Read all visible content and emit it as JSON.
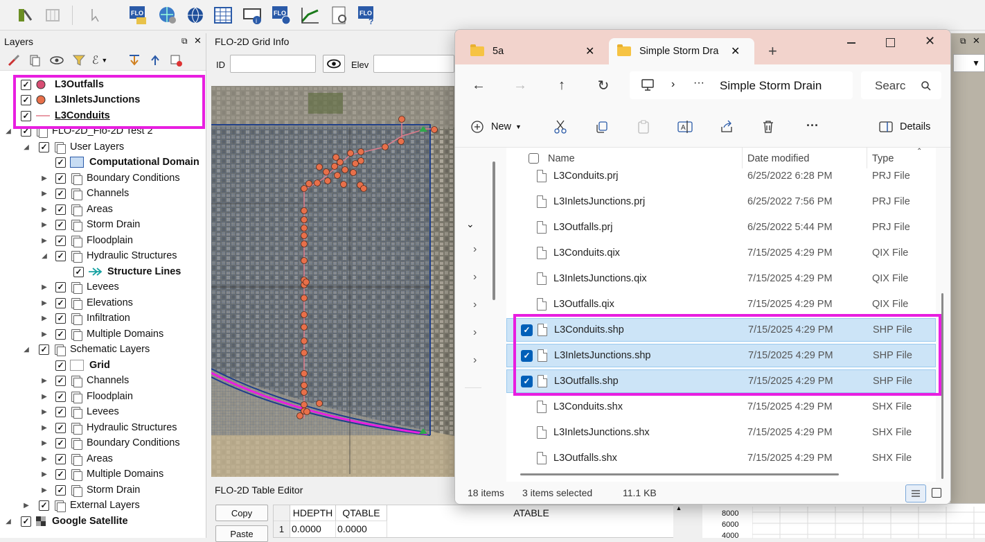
{
  "toolbar": {
    "icons": [
      "flo2d-settings-icon",
      "grid-tools-icon",
      "select-tool-icon",
      "flo2d-import-icon",
      "world-settings-icon",
      "globe-icon",
      "grid-table-icon",
      "info-tool-icon",
      "flo2d-info-icon",
      "profile-icon",
      "report-icon",
      "flo2d-help-icon"
    ]
  },
  "layers": {
    "title": "Layers",
    "items": [
      {
        "label": "L3Outfalls",
        "bold": true,
        "symbol": "point-pink"
      },
      {
        "label": "L3InletsJunctions",
        "bold": true,
        "symbol": "point-orange"
      },
      {
        "label": "L3Conduits",
        "bold": true,
        "symbol": "line-pink"
      },
      {
        "label": "FLO-2D_Flo-2D Test 2"
      },
      {
        "label": "User Layers"
      },
      {
        "label": "Computational Domain",
        "bold": true
      },
      {
        "label": "Boundary Conditions"
      },
      {
        "label": "Channels"
      },
      {
        "label": "Areas"
      },
      {
        "label": "Storm Drain"
      },
      {
        "label": "Floodplain"
      },
      {
        "label": "Hydraulic Structures"
      },
      {
        "label": "Structure Lines",
        "bold": true
      },
      {
        "label": "Levees"
      },
      {
        "label": "Elevations"
      },
      {
        "label": "Infiltration"
      },
      {
        "label": "Multiple Domains"
      },
      {
        "label": "Schematic Layers"
      },
      {
        "label": "Grid",
        "bold": true
      },
      {
        "label": "Channels"
      },
      {
        "label": "Floodplain"
      },
      {
        "label": "Levees"
      },
      {
        "label": "Hydraulic Structures"
      },
      {
        "label": "Boundary Conditions"
      },
      {
        "label": "Areas"
      },
      {
        "label": "Multiple Domains"
      },
      {
        "label": "Storm Drain"
      },
      {
        "label": "External Layers"
      },
      {
        "label": "Google Satellite",
        "bold": true
      }
    ]
  },
  "grid_info": {
    "title": "FLO-2D Grid Info",
    "id_label": "ID",
    "elev_label": "Elev"
  },
  "table_editor": {
    "title": "FLO-2D Table Editor",
    "copy": "Copy",
    "paste": "Paste",
    "columns": [
      "HDEPTH",
      "QTABLE",
      "ATABLE"
    ],
    "row": {
      "num": "1",
      "hdepth": "0.0000",
      "qtable": "0.0000"
    }
  },
  "plot": {
    "ticks": [
      "8000",
      "6000",
      "4000"
    ]
  },
  "explorer": {
    "tabs": [
      {
        "label": "5a"
      },
      {
        "label": "Simple Storm Dra"
      }
    ],
    "breadcrumb": "Simple Storm Drain",
    "search_placeholder": "Searc",
    "new_label": "New",
    "details_label": "Details",
    "columns": {
      "name": "Name",
      "date": "Date modified",
      "type": "Type"
    },
    "files": [
      {
        "name": "L3Conduits.prj",
        "date": "6/25/2022 6:28 PM",
        "type": "PRJ File",
        "selected": false
      },
      {
        "name": "L3InletsJunctions.prj",
        "date": "6/25/2022 7:56 PM",
        "type": "PRJ File",
        "selected": false
      },
      {
        "name": "L3Outfalls.prj",
        "date": "6/25/2022 5:44 PM",
        "type": "PRJ File",
        "selected": false
      },
      {
        "name": "L3Conduits.qix",
        "date": "7/15/2025 4:29 PM",
        "type": "QIX File",
        "selected": false
      },
      {
        "name": "L3InletsJunctions.qix",
        "date": "7/15/2025 4:29 PM",
        "type": "QIX File",
        "selected": false
      },
      {
        "name": "L3Outfalls.qix",
        "date": "7/15/2025 4:29 PM",
        "type": "QIX File",
        "selected": false
      },
      {
        "name": "L3Conduits.shp",
        "date": "7/15/2025 4:29 PM",
        "type": "SHP File",
        "selected": true
      },
      {
        "name": "L3InletsJunctions.shp",
        "date": "7/15/2025 4:29 PM",
        "type": "SHP File",
        "selected": true
      },
      {
        "name": "L3Outfalls.shp",
        "date": "7/15/2025 4:29 PM",
        "type": "SHP File",
        "selected": true
      },
      {
        "name": "L3Conduits.shx",
        "date": "7/15/2025 4:29 PM",
        "type": "SHX File",
        "selected": false
      },
      {
        "name": "L3InletsJunctions.shx",
        "date": "7/15/2025 4:29 PM",
        "type": "SHX File",
        "selected": false
      },
      {
        "name": "L3Outfalls.shx",
        "date": "7/15/2025 4:29 PM",
        "type": "SHX File",
        "selected": false
      }
    ],
    "status": {
      "count": "18 items",
      "selected": "3 items selected",
      "size": "11.1 KB"
    }
  },
  "colors": {
    "highlight": "#e81ee0",
    "selection": "#cce4f7",
    "accent": "#005fb8",
    "node": "#e8704a",
    "tab_strip": "#f2d3cc"
  }
}
